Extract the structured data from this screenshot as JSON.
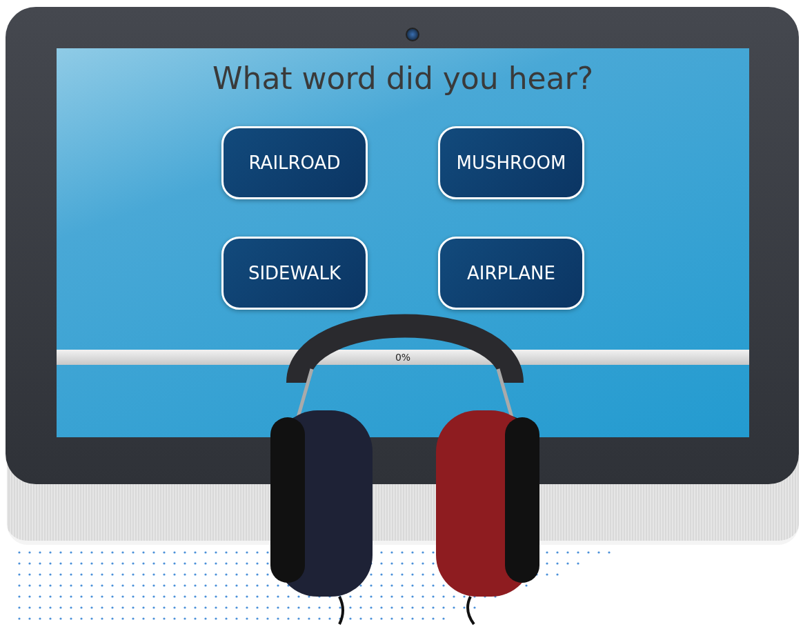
{
  "screen": {
    "question": "What word did you hear?",
    "choices": [
      {
        "label": "RAILROAD"
      },
      {
        "label": "MUSHROOM"
      },
      {
        "label": "SIDEWALK"
      },
      {
        "label": "AIRPLANE"
      }
    ],
    "progress": {
      "level": 0,
      "reading": "0%"
    }
  }
}
